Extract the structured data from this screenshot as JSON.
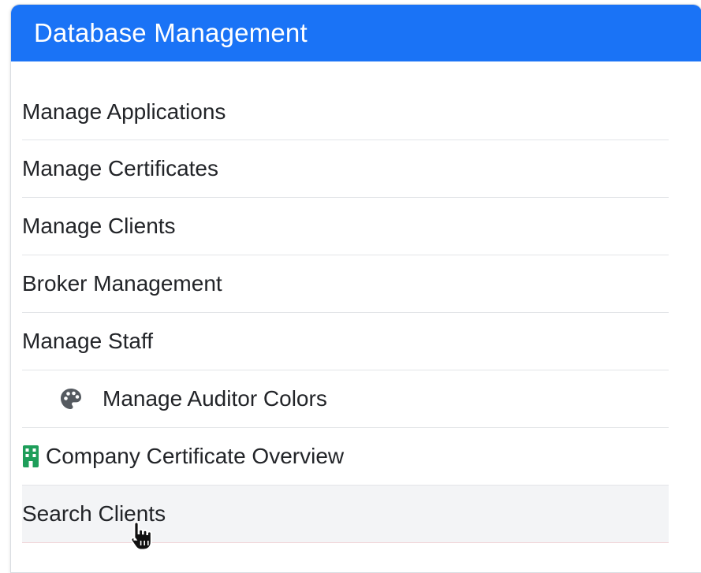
{
  "header": {
    "title": "Database Management"
  },
  "menu": {
    "items": [
      {
        "label": "Manage Applications"
      },
      {
        "label": "Manage Certificates"
      },
      {
        "label": "Manage Clients"
      },
      {
        "label": "Broker Management"
      },
      {
        "label": "Manage Staff"
      },
      {
        "label": "Manage Auditor Colors",
        "icon": "palette-icon"
      },
      {
        "label": "Company Certificate Overview",
        "icon": "building-icon"
      },
      {
        "label": "Search Clients",
        "state": "hovered"
      }
    ]
  },
  "colors": {
    "header_bg": "#1a73f6",
    "building_icon": "#1e9e5a",
    "palette_icon": "#555a60"
  }
}
